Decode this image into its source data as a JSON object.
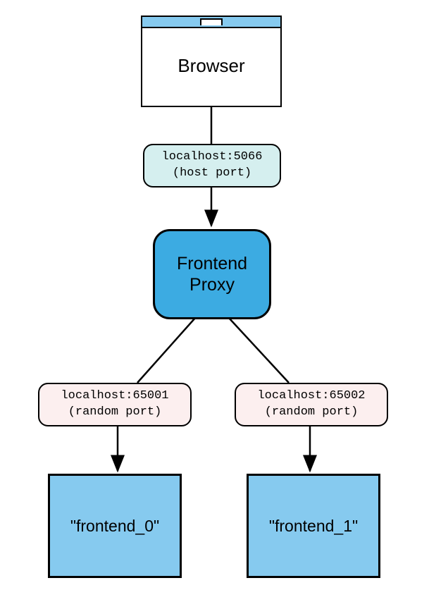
{
  "nodes": {
    "browser": {
      "label": "Browser"
    },
    "proxy": {
      "line1": "Frontend",
      "line2": "Proxy"
    },
    "frontend0": {
      "label": "\"frontend_0\""
    },
    "frontend1": {
      "label": "\"frontend_1\""
    }
  },
  "edges": {
    "browser_to_proxy": {
      "line1": "localhost:5066",
      "line2": "(host port)"
    },
    "proxy_to_f0": {
      "line1": "localhost:65001",
      "line2": "(random port)"
    },
    "proxy_to_f1": {
      "line1": "localhost:65002",
      "line2": "(random port)"
    }
  },
  "colors": {
    "light_blue": "#86caef",
    "mid_blue": "#3cabe2",
    "pale_cyan": "#d5efef",
    "pale_pink": "#fcefef"
  }
}
